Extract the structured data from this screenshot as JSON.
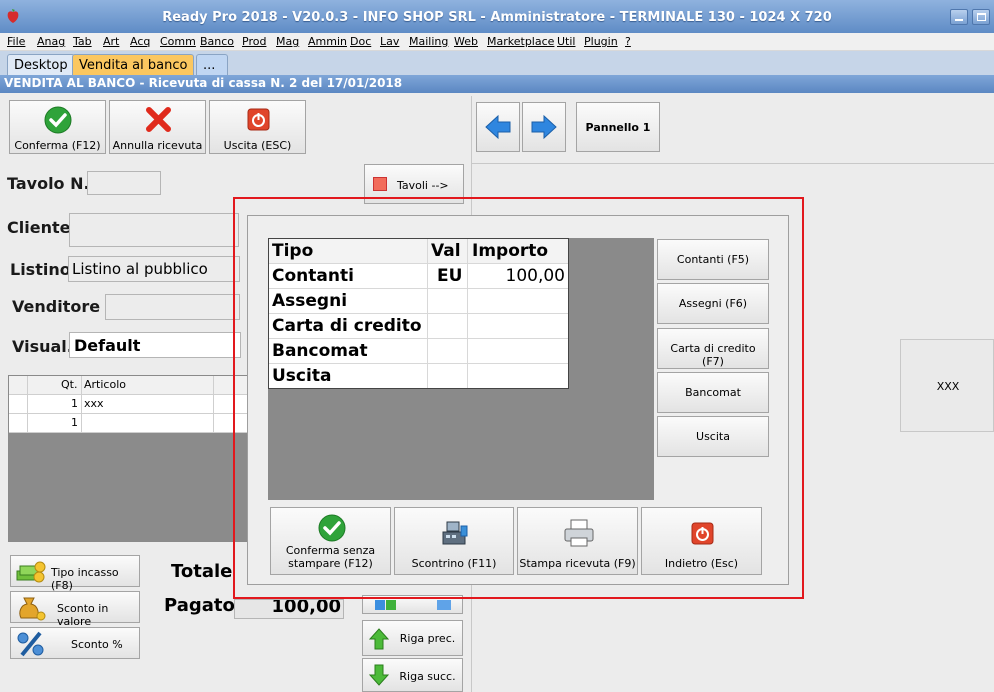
{
  "window": {
    "title": "Ready Pro 2018 - V20.0.3 - INFO SHOP SRL - Amministratore - TERMINALE 130 - 1024 X 720"
  },
  "menu": [
    "File",
    "Anag",
    "Tab",
    "Art",
    "Acq",
    "Comm",
    "Banco",
    "Prod",
    "Mag",
    "Ammin",
    "Doc",
    "Lav",
    "Mailing",
    "Web",
    "Marketplace",
    "Util",
    "Plugin",
    "?"
  ],
  "tabs": {
    "desktop": "Desktop",
    "vendita": "Vendita al banco",
    "more": "..."
  },
  "subtitle": "VENDITA AL BANCO - Ricevuta di cassa N. 2 del 17/01/2018",
  "toolbar": {
    "confirm": "Conferma (F12)",
    "cancel": "Annulla ricevuta",
    "exit": "Uscita (ESC)",
    "panel": "Pannello 1",
    "tables": "Tavoli -->"
  },
  "form": {
    "table_label": "Tavolo N.",
    "table_value": "",
    "client_label": "Cliente",
    "client_value": "",
    "pricelist_label": "Listino",
    "pricelist_value": "Listino al pubblico",
    "seller_label": "Venditore",
    "seller_value": "",
    "view_label": "Visual.",
    "view_value": "Default"
  },
  "grid": {
    "col_qty": "Qt.",
    "col_article": "Articolo",
    "rows": [
      {
        "qty": "1",
        "article": "xxx"
      },
      {
        "qty": "1",
        "article": ""
      }
    ]
  },
  "left_buttons": {
    "payment_type": "Tipo incasso (F8)",
    "discount_value": "Sconto in valore",
    "discount_pct": "Sconto %"
  },
  "totals": {
    "total_label": "Totale",
    "paid_label": "Pagato",
    "paid_value": "100,00"
  },
  "row_nav": {
    "prev": "Riga prec.",
    "next": "Riga succ."
  },
  "right_panel": {
    "xxx": "XXX"
  },
  "payment_dialog": {
    "headers": {
      "type": "Tipo",
      "currency": "Val",
      "amount": "Importo"
    },
    "rows": [
      {
        "type": "Contanti",
        "currency": "EU",
        "amount": "100,00"
      },
      {
        "type": "Assegni",
        "currency": "",
        "amount": ""
      },
      {
        "type": "Carta di credito",
        "currency": "",
        "amount": ""
      },
      {
        "type": "Bancomat",
        "currency": "",
        "amount": ""
      },
      {
        "type": "Uscita",
        "currency": "",
        "amount": ""
      }
    ],
    "side_buttons": {
      "cash": "Contanti (F5)",
      "checks": "Assegni (F6)",
      "card": "Carta di credito (F7)",
      "bancomat": "Bancomat",
      "exit": "Uscita"
    },
    "bottom_buttons": {
      "confirm_no_print": "Conferma senza stampare (F12)",
      "receipt": "Scontrino (F11)",
      "print_receipt": "Stampa ricevuta (F9)",
      "back": "Indietro (Esc)"
    }
  },
  "colors": {
    "titlebar": "#6f98cf",
    "active_tab": "#fbc760",
    "highlight": "#e2181d"
  }
}
